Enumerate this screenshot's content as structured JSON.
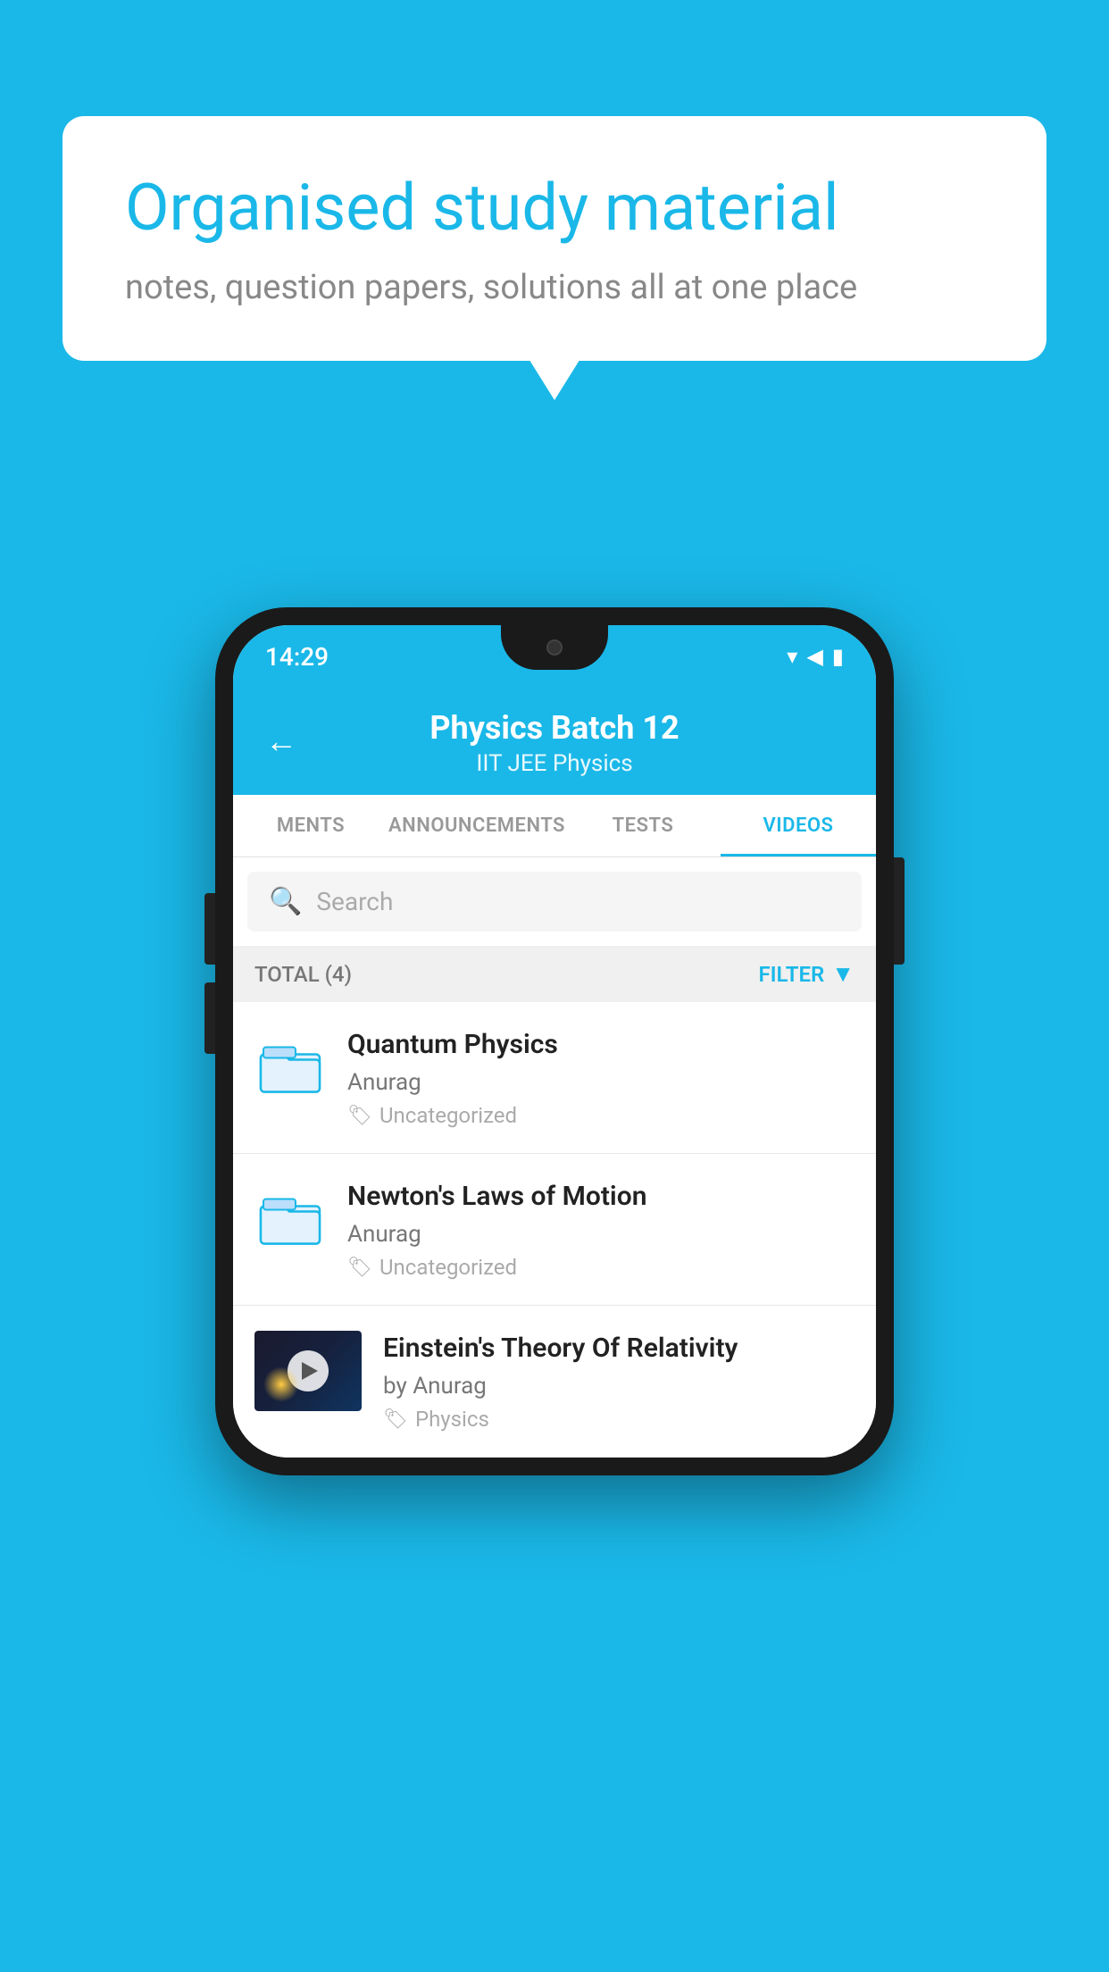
{
  "background_color": "#1ab8e8",
  "bubble": {
    "title": "Organised study material",
    "subtitle": "notes, question papers, solutions all at one place"
  },
  "phone": {
    "status_bar": {
      "time": "14:29",
      "wifi": "▾",
      "signal": "▴",
      "battery": "▮"
    },
    "header": {
      "back_label": "←",
      "title": "Physics Batch 12",
      "subtitle": "IIT JEE   Physics"
    },
    "tabs": [
      {
        "label": "MENTS",
        "active": false
      },
      {
        "label": "ANNOUNCEMENTS",
        "active": false
      },
      {
        "label": "TESTS",
        "active": false
      },
      {
        "label": "VIDEOS",
        "active": true
      }
    ],
    "search": {
      "placeholder": "Search"
    },
    "filter_bar": {
      "total": "TOTAL (4)",
      "filter_label": "FILTER"
    },
    "videos": [
      {
        "id": 1,
        "title": "Quantum Physics",
        "author": "Anurag",
        "tag": "Uncategorized",
        "type": "folder"
      },
      {
        "id": 2,
        "title": "Newton's Laws of Motion",
        "author": "Anurag",
        "tag": "Uncategorized",
        "type": "folder"
      },
      {
        "id": 3,
        "title": "Einstein's Theory Of Relativity",
        "author": "by Anurag",
        "tag": "Physics",
        "type": "video"
      }
    ]
  }
}
